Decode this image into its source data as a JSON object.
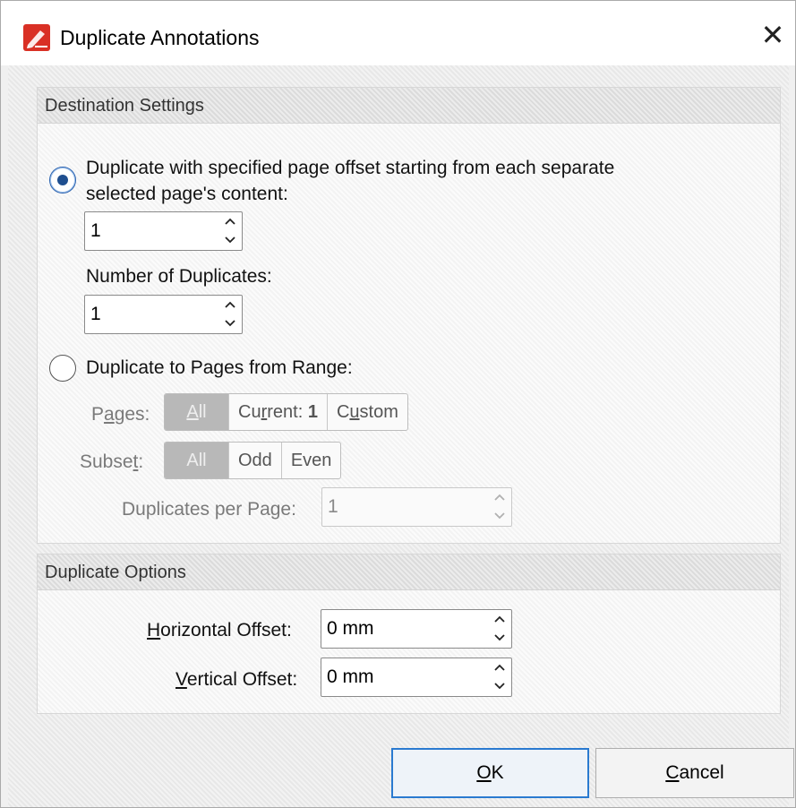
{
  "window": {
    "title": "Duplicate Annotations",
    "close_glyph": "✕"
  },
  "destination": {
    "header": "Destination Settings",
    "option_offset_label_line1": "Duplicate with specified page offset starting from each separate",
    "option_offset_label_line2": "selected page's content:",
    "offset_value": "1",
    "num_duplicates_label": "Number of Duplicates:",
    "num_duplicates_value": "1",
    "option_range_label": "Duplicate to Pages from Range:",
    "pages_label_pre": "P",
    "pages_label_acc": "a",
    "pages_label_post": "ges:",
    "pages_segments": {
      "all_acc": "A",
      "all_rest": "ll",
      "current_pre": "Cu",
      "current_acc": "r",
      "current_rest": "rent: ",
      "current_num": "1",
      "custom_pre": "C",
      "custom_acc": "u",
      "custom_rest": "stom"
    },
    "subset_label_pre": "Subse",
    "subset_label_acc": "t",
    "subset_label_post": ":",
    "subset_segments": [
      "All",
      "Odd",
      "Even"
    ],
    "dup_per_page_label": "Duplicates per Page:",
    "dup_per_page_value": "1"
  },
  "options": {
    "header": "Duplicate Options",
    "h_offset_acc": "H",
    "h_offset_rest": "orizontal Offset:",
    "h_offset_value": "0 mm",
    "v_offset_acc": "V",
    "v_offset_rest": "ertical Offset:",
    "v_offset_value": "0 mm"
  },
  "buttons": {
    "ok_acc": "O",
    "ok_rest": "K",
    "cancel_acc": "C",
    "cancel_rest": "ancel"
  },
  "colors": {
    "accent": "#2a7ad0",
    "app_icon_red": "#d93025"
  }
}
